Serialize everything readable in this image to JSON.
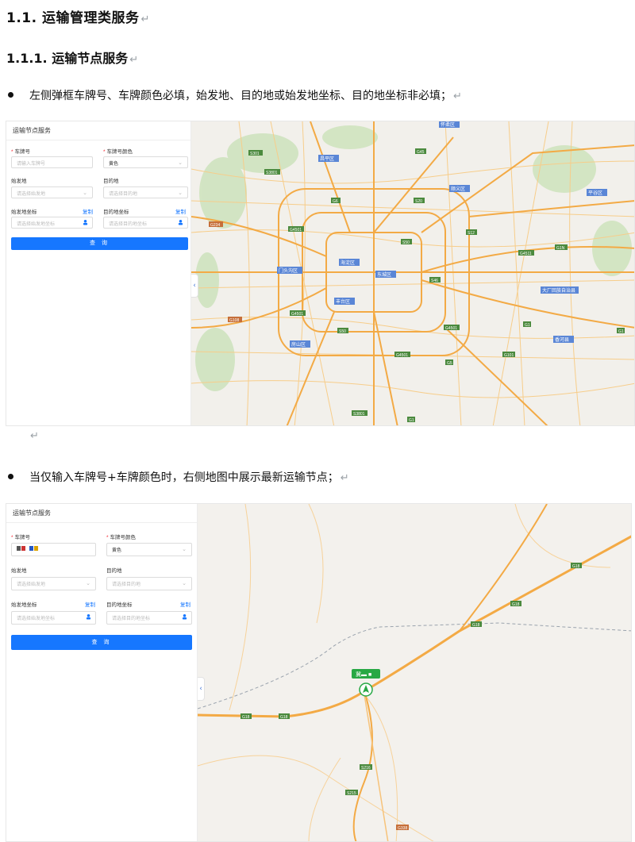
{
  "doc": {
    "heading1": "1.1.  运输管理类服务",
    "heading2": "1.1.1. 运输节点服务",
    "return_mark": "↵",
    "bullet1": "左侧弹框车牌号、车牌颜色必填，始发地、目的地或始发地坐标、目的地坐标非必填；",
    "bullet2": "当仅输入车牌号+车牌颜色时，右侧地图中展示最新运输节点；"
  },
  "panel": {
    "title": "运输节点服务",
    "required_mark": "*",
    "plate_label": "车牌号",
    "plate_color_label": "车牌号颜色",
    "plate_placeholder": "请输入车牌号",
    "plate_color_value": "黄色",
    "origin_label": "始发地",
    "origin_placeholder": "请选择始发地",
    "dest_label": "目的地",
    "dest_placeholder": "请选择目的地",
    "origin_coord_label": "始发地坐标",
    "origin_coord_placeholder": "请选择始发地坐标",
    "dest_coord_label": "目的地坐标",
    "dest_coord_placeholder": "请选择目的地坐标",
    "copy_label": "复制",
    "query_label": "查 询"
  },
  "map1": {
    "districts": [
      "昌平区",
      "顺义区",
      "平谷区",
      "门头沟区",
      "海淀区",
      "东城区",
      "丰台区",
      "大厂回族自治县",
      "房山区",
      "香河县",
      "怀柔区"
    ],
    "roads": [
      "S301",
      "S3801",
      "G45",
      "S20",
      "S12",
      "G4501",
      "G234",
      "G4511",
      "G1N",
      "G6",
      "S50",
      "S46",
      "G108",
      "G4501",
      "S50",
      "G4501",
      "G1",
      "G1",
      "G5",
      "G101",
      "S3801",
      "G1",
      "G4501"
    ]
  },
  "map2": {
    "roads": [
      "G18",
      "G18",
      "G18",
      "G18",
      "G18",
      "S216",
      "S215",
      "G338"
    ],
    "vehicle_label": "冀▬ ■"
  },
  "colors": {
    "primary": "#1677ff",
    "road": "#f5b151",
    "green_marker": "#27a844",
    "map_bg": "#f3f1ed",
    "district_blue": "#5a86d6"
  }
}
